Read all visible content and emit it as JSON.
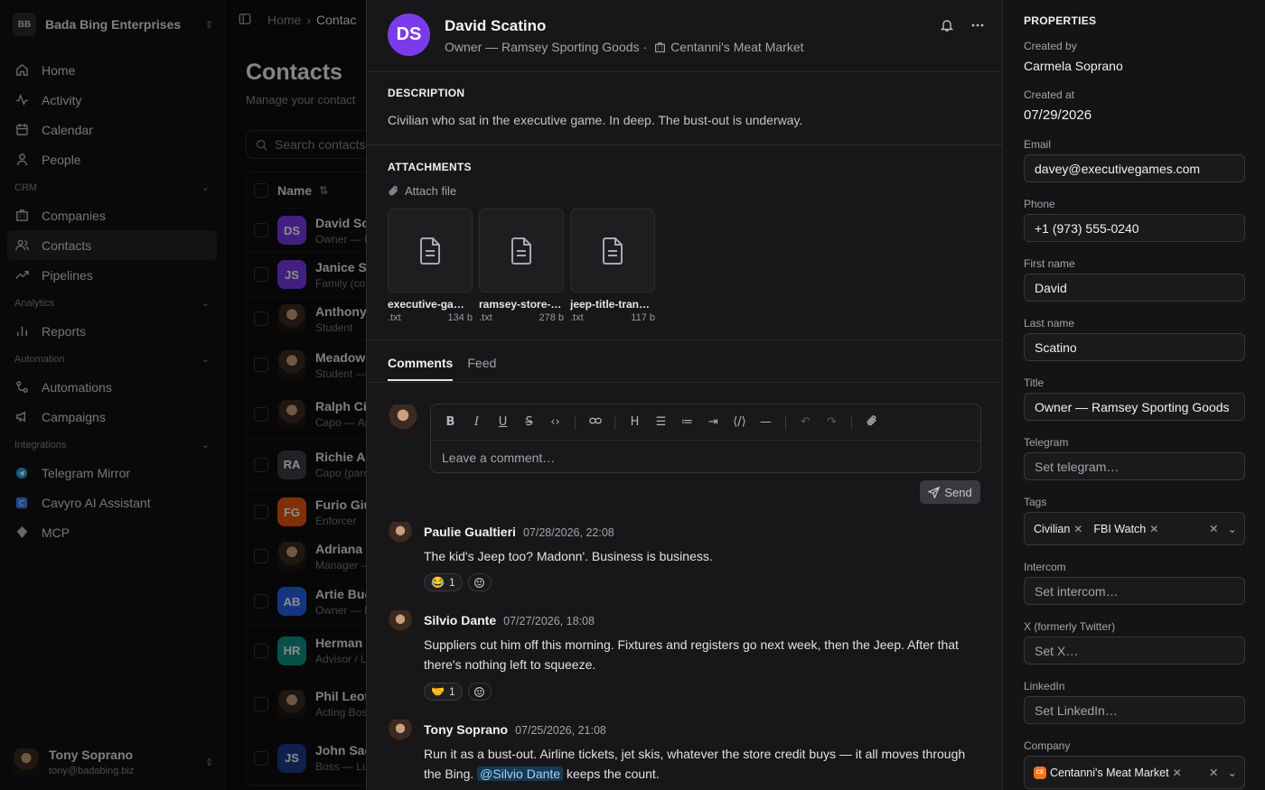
{
  "workspace": {
    "initials": "BB",
    "name": "Bada Bing Enterprises"
  },
  "nav": {
    "home": "Home",
    "activity": "Activity",
    "calendar": "Calendar",
    "people": "People",
    "crm": "CRM",
    "companies": "Companies",
    "contacts": "Contacts",
    "pipelines": "Pipelines",
    "analytics": "Analytics",
    "reports": "Reports",
    "automation": "Automation",
    "automations": "Automations",
    "campaigns": "Campaigns",
    "integrations": "Integrations",
    "telegram": "Telegram Mirror",
    "cavyro": "Cavyro AI Assistant",
    "mcp": "MCP"
  },
  "user": {
    "name": "Tony Soprano",
    "email": "tony@badabing.biz"
  },
  "list": {
    "crumb_home": "Home",
    "crumb_current": "Contac",
    "title": "Contacts",
    "subtitle": "Manage your contact",
    "search_placeholder": "Search contacts",
    "col_name": "Name",
    "rows": [
      {
        "initials": "DS",
        "name": "David Sc",
        "sub": "Owner — R"
      },
      {
        "initials": "JS",
        "name": "Janice S",
        "sub": "Family (con"
      },
      {
        "initials": "",
        "name": "Anthony",
        "sub": "Student"
      },
      {
        "initials": "",
        "name": "Meadow",
        "sub": "Student —"
      },
      {
        "initials": "",
        "name": "Ralph Ci",
        "sub": "Capo — Ap"
      },
      {
        "initials": "RA",
        "name": "Richie Ap",
        "sub": "Capo (paro"
      },
      {
        "initials": "FG",
        "name": "Furio Giu",
        "sub": "Enforcer"
      },
      {
        "initials": "",
        "name": "Adriana L",
        "sub": "Manager —"
      },
      {
        "initials": "AB",
        "name": "Artie Buc",
        "sub": "Owner — N"
      },
      {
        "initials": "HR",
        "name": "Herman F",
        "sub": "Advisor / L"
      },
      {
        "initials": "",
        "name": "Phil Leot",
        "sub": "Acting Bos"
      },
      {
        "initials": "JS",
        "name": "John Sac",
        "sub": "Boss — Lu"
      }
    ]
  },
  "contact": {
    "initials": "DS",
    "name": "David Scatino",
    "subtitle": "Owner — Ramsey Sporting Goods ·",
    "company": "Centanni's Meat Market"
  },
  "description": {
    "title": "DESCRIPTION",
    "text": "Civilian who sat in the executive game. In deep. The bust-out is underway."
  },
  "attachments": {
    "title": "ATTACHMENTS",
    "attach_label": "Attach file",
    "files": [
      {
        "name": "executive-gam…",
        "ext": ".txt",
        "size": "134 b"
      },
      {
        "name": "ramsey-store-c…",
        "ext": ".txt",
        "size": "278 b"
      },
      {
        "name": "jeep-title-trans…",
        "ext": ".txt",
        "size": "117 b"
      }
    ]
  },
  "tabs": {
    "comments": "Comments",
    "feed": "Feed"
  },
  "editor": {
    "placeholder": "Leave a comment…",
    "send": "Send"
  },
  "comments": [
    {
      "author": "Paulie Gualtieri",
      "time": "07/28/2026, 22:08",
      "body": "The kid's Jeep too? Madonn'. Business is business.",
      "reaction": "😂",
      "count": "1"
    },
    {
      "author": "Silvio Dante",
      "time": "07/27/2026, 18:08",
      "body": "Suppliers cut him off this morning. Fixtures and registers go next week, then the Jeep. After that there's nothing left to squeeze.",
      "reaction": "🤝",
      "count": "1"
    },
    {
      "author": "Tony Soprano",
      "time": "07/25/2026, 21:08",
      "body_pre": "Run it as a bust-out. Airline tickets, jet skis, whatever the store credit buys — it all moves through the Bing.",
      "mention": "@Silvio Dante",
      "body_post": "keeps the count."
    }
  ],
  "properties": {
    "title": "PROPERTIES",
    "created_by_label": "Created by",
    "created_by": "Carmela Soprano",
    "created_at_label": "Created at",
    "created_at": "07/29/2026",
    "email_label": "Email",
    "email": "davey@executivegames.com",
    "phone_label": "Phone",
    "phone": "+1 (973) 555-0240",
    "first_label": "First name",
    "first": "David",
    "last_label": "Last name",
    "last": "Scatino",
    "title_label": "Title",
    "title_value": "Owner — Ramsey Sporting Goods",
    "telegram_label": "Telegram",
    "telegram_ph": "Set telegram…",
    "tags_label": "Tags",
    "tag1": "Civilian",
    "tag2": "FBI Watch",
    "intercom_label": "Intercom",
    "intercom_ph": "Set intercom…",
    "x_label": "X (formerly Twitter)",
    "x_ph": "Set X…",
    "linkedin_label": "LinkedIn",
    "linkedin_ph": "Set LinkedIn…",
    "company_label": "Company",
    "company_initials": "CE",
    "company": "Centanni's Meat Market"
  },
  "colors": {
    "accent_avatar": "#7c3aed",
    "mention_bg": "#163a52"
  }
}
